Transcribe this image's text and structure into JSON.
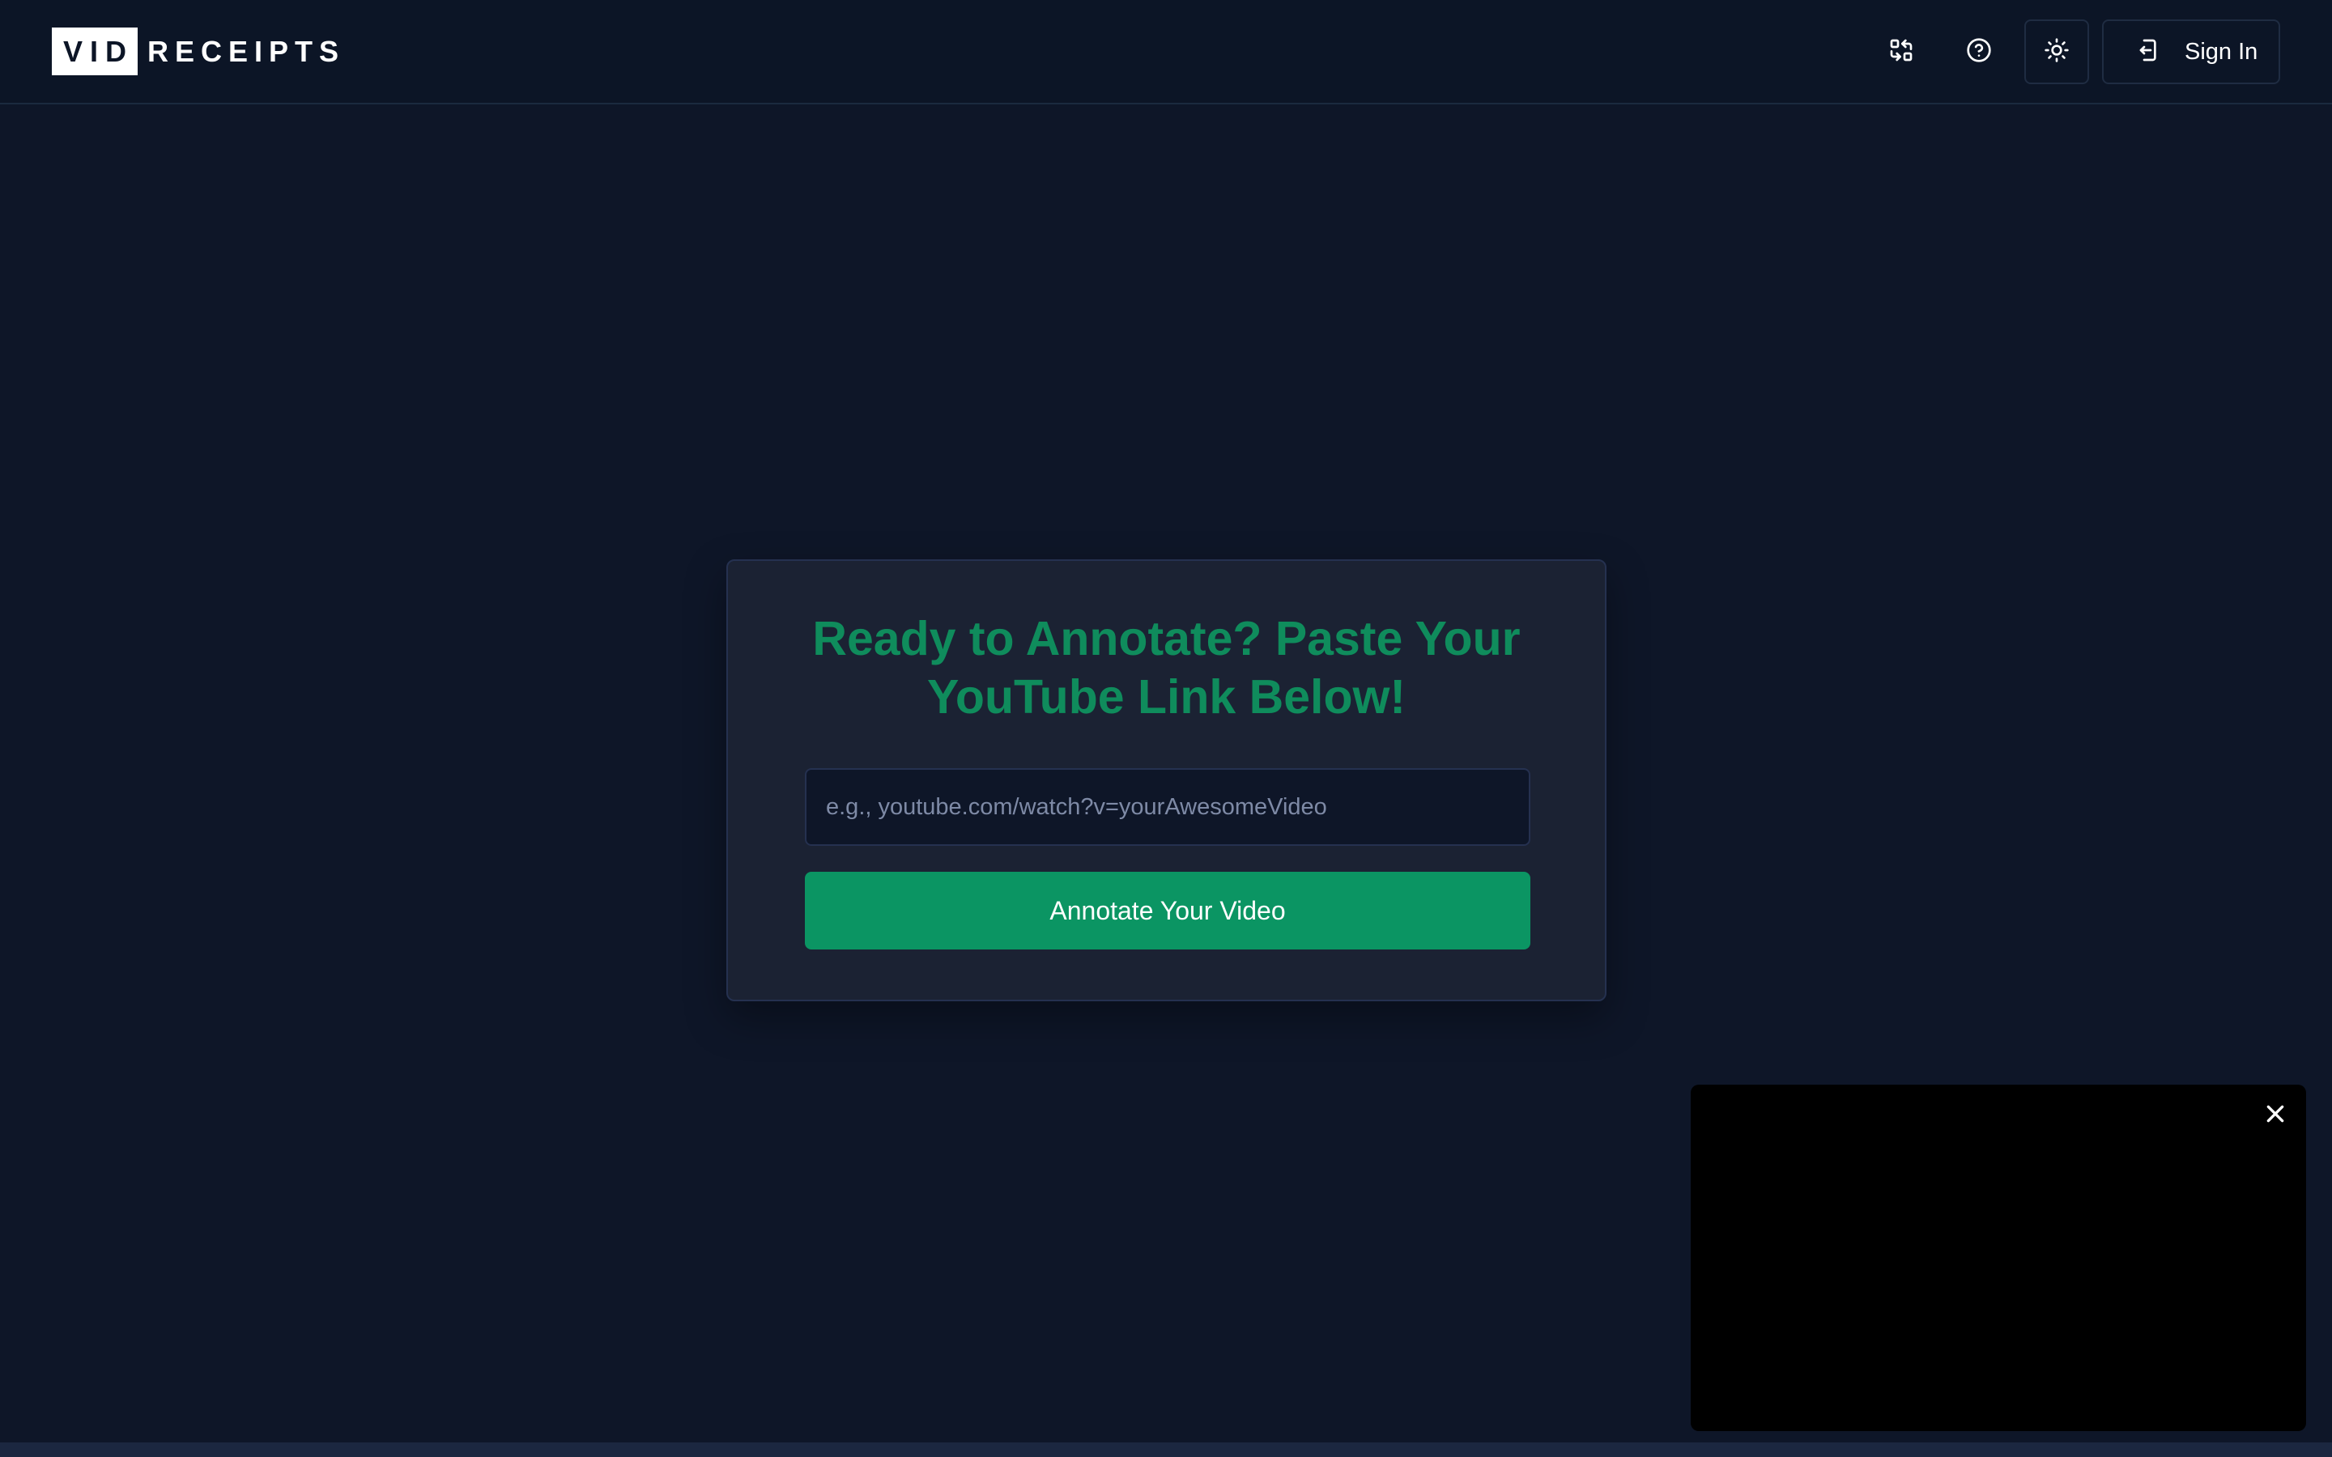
{
  "header": {
    "logo": {
      "box_text": "VID",
      "text": "RECEIPTS"
    },
    "icons": {
      "switch": "switch-arrows-icon",
      "help": "help-circle-icon",
      "theme": "sun-icon",
      "signin": "log-in-icon"
    },
    "signin_label": "Sign In"
  },
  "main": {
    "title": "Ready to Annotate? Paste Your YouTube Link Below!",
    "url_input": {
      "placeholder": "e.g., youtube.com/watch?v=yourAwesomeVideo",
      "value": ""
    },
    "submit_label": "Annotate Your Video"
  },
  "video_panel": {
    "close_icon": "close-icon"
  },
  "colors": {
    "background": "#0e1628",
    "header_background": "#0c1526",
    "card_background": "#1b2233",
    "accent_green": "#0f8c5c",
    "button_green": "#0b9563",
    "video_background": "#000000"
  }
}
